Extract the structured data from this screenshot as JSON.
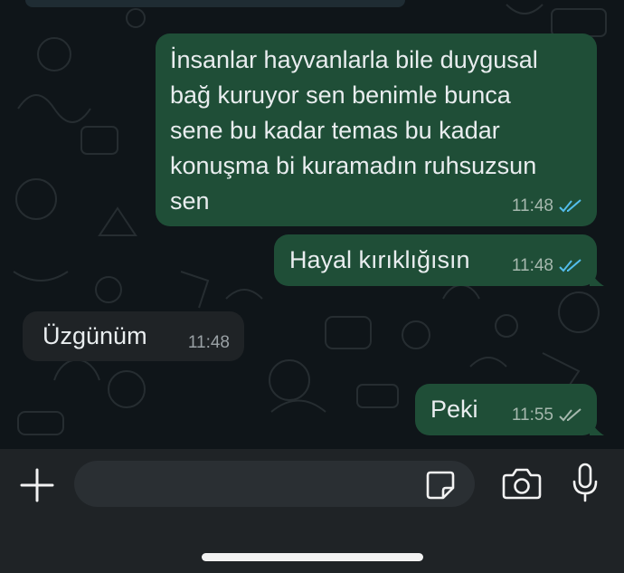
{
  "chat": {
    "messages": [
      {
        "direction": "outgoing",
        "text": "İnsanlar hayvanlarla bile duygusal\nbağ kuruyor sen benimle bunca\nsene bu kadar temas bu kadar\nkonuşma bi kuramadın ruhsuzsun\nsen",
        "time": "11:48",
        "status": "read"
      },
      {
        "direction": "outgoing",
        "text": "Hayal kırıklığısın",
        "time": "11:48",
        "status": "read"
      },
      {
        "direction": "incoming",
        "text": "Üzgünüm",
        "time": "11:48"
      },
      {
        "direction": "outgoing",
        "text": "Peki",
        "time": "11:55",
        "status": "delivered"
      }
    ]
  },
  "composer": {
    "input_value": "",
    "icons": {
      "attach": "plus-icon",
      "sticker": "sticker-icon",
      "camera": "camera-icon",
      "mic": "microphone-icon"
    }
  },
  "colors": {
    "outgoing_bubble": "#1f4e37",
    "incoming_bubble": "#1f2326",
    "read_ticks": "#53bdeb",
    "delivered_ticks": "#a6b8ae",
    "background": "#0f1519",
    "composer_bar": "#1f2326"
  }
}
